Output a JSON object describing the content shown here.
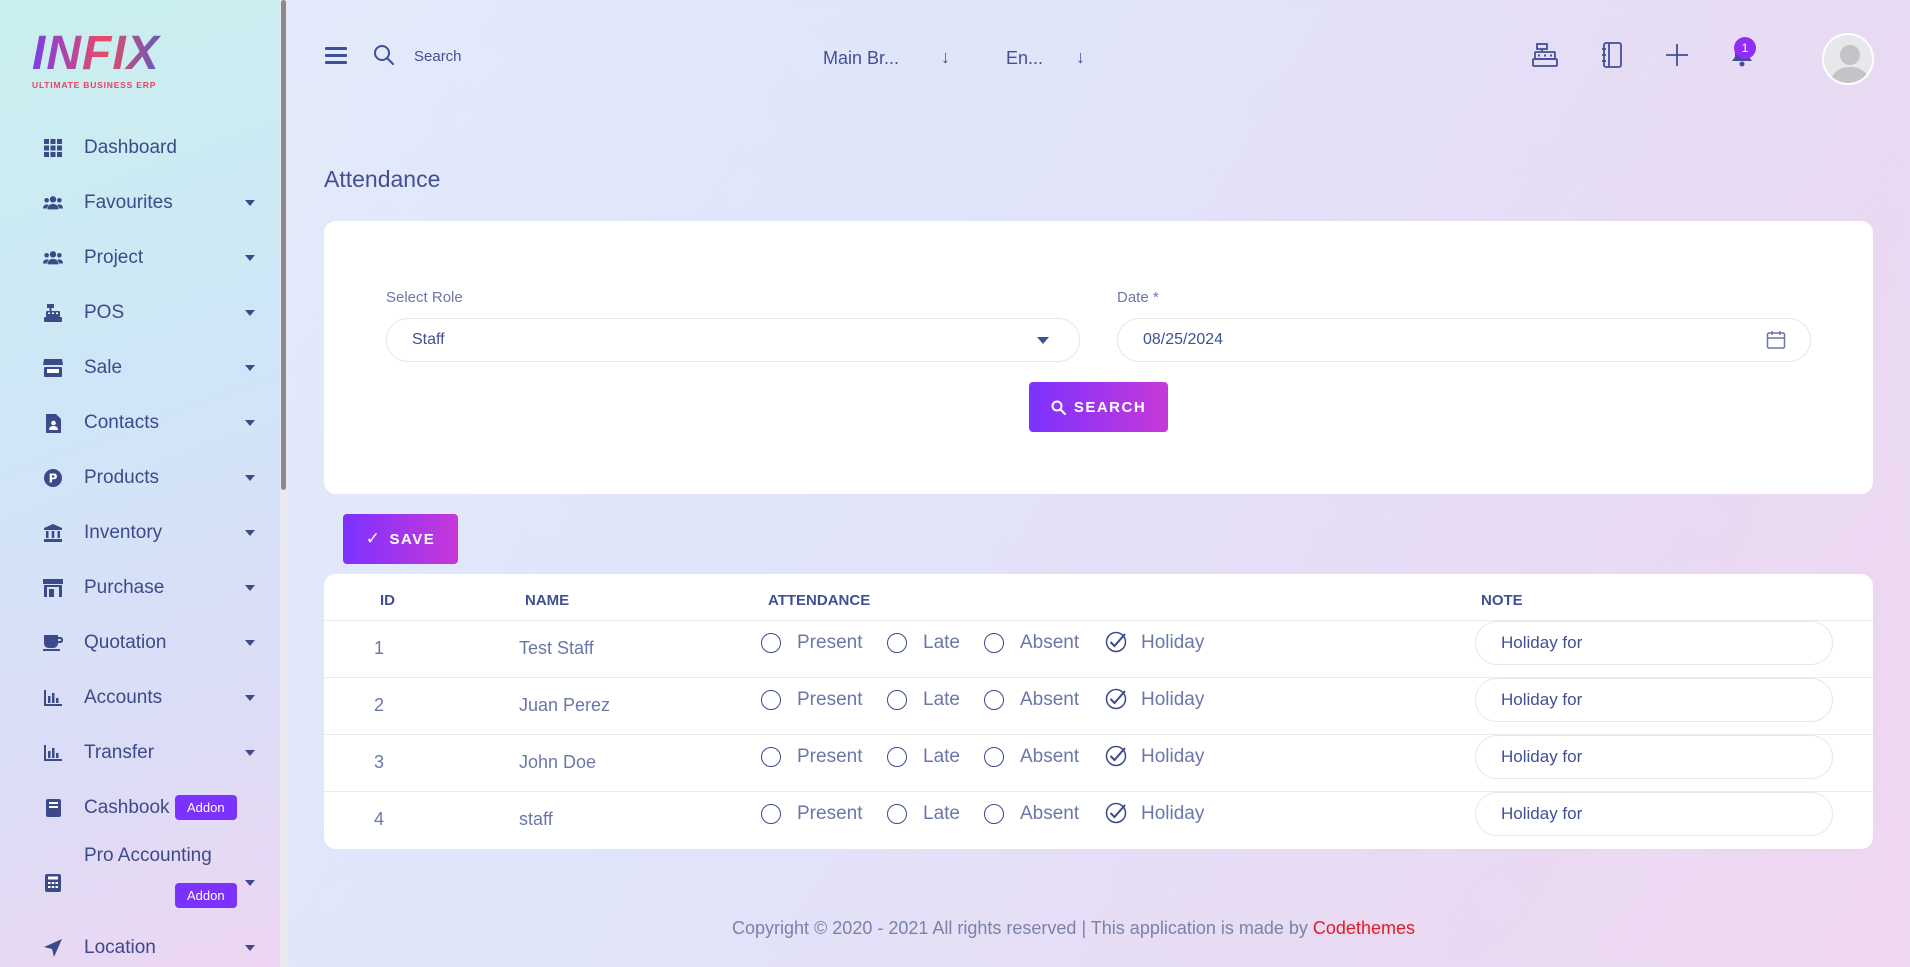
{
  "logo": {
    "name": "INFIX",
    "tagline": "ULTIMATE BUSINESS ERP"
  },
  "sidebar": {
    "items": [
      {
        "label": "Dashboard",
        "icon": "grid-icon",
        "caret": false
      },
      {
        "label": "Favourites",
        "icon": "users-icon",
        "caret": true
      },
      {
        "label": "Project",
        "icon": "users-icon",
        "caret": true
      },
      {
        "label": "POS",
        "icon": "cash-register-icon",
        "caret": true
      },
      {
        "label": "Sale",
        "icon": "store-icon",
        "caret": true
      },
      {
        "label": "Contacts",
        "icon": "contact-file-icon",
        "caret": true
      },
      {
        "label": "Products",
        "icon": "product-p-icon",
        "caret": true
      },
      {
        "label": "Inventory",
        "icon": "bank-icon",
        "caret": true
      },
      {
        "label": "Purchase",
        "icon": "shop-icon",
        "caret": true
      },
      {
        "label": "Quotation",
        "icon": "cup-icon",
        "caret": true
      },
      {
        "label": "Accounts",
        "icon": "bar-chart-icon",
        "caret": true
      },
      {
        "label": "Transfer",
        "icon": "bar-chart-icon",
        "caret": true
      },
      {
        "label": "Cashbook",
        "icon": "book-icon",
        "caret": false,
        "badge": "Addon"
      },
      {
        "label": "Pro Accounting",
        "icon": "calculator-icon",
        "caret": true,
        "badge": "Addon"
      },
      {
        "label": "Location",
        "icon": "location-arrow-icon",
        "caret": true
      }
    ]
  },
  "topbar": {
    "search_label": "Search",
    "branch": "Main Br...",
    "language": "En...",
    "notification_count": "1"
  },
  "page": {
    "title": "Attendance",
    "role_label": "Select Role",
    "role_value": "Staff",
    "date_label": "Date *",
    "date_value": "08/25/2024",
    "search_button": "SEARCH",
    "save_button": "SAVE"
  },
  "table": {
    "headers": {
      "id": "ID",
      "name": "NAME",
      "attendance": "ATTENDANCE",
      "note": "NOTE"
    },
    "options": [
      "Present",
      "Late",
      "Absent",
      "Holiday"
    ],
    "rows": [
      {
        "id": "1",
        "name": "Test Staff",
        "selected": "Holiday",
        "note": "Holiday for"
      },
      {
        "id": "2",
        "name": "Juan Perez",
        "selected": "Holiday",
        "note": "Holiday for"
      },
      {
        "id": "3",
        "name": "John Doe",
        "selected": "Holiday",
        "note": "Holiday for"
      },
      {
        "id": "4",
        "name": "staff",
        "selected": "Holiday",
        "note": "Holiday for"
      }
    ]
  },
  "footer": {
    "text": "Copyright © 2020 - 2021 All rights reserved | This application is made by ",
    "brand": "Codethemes"
  },
  "colors": {
    "accent": "#7c32ff",
    "accent2": "#c738d8",
    "text": "#415094",
    "footer_brand": "#e31b23"
  }
}
